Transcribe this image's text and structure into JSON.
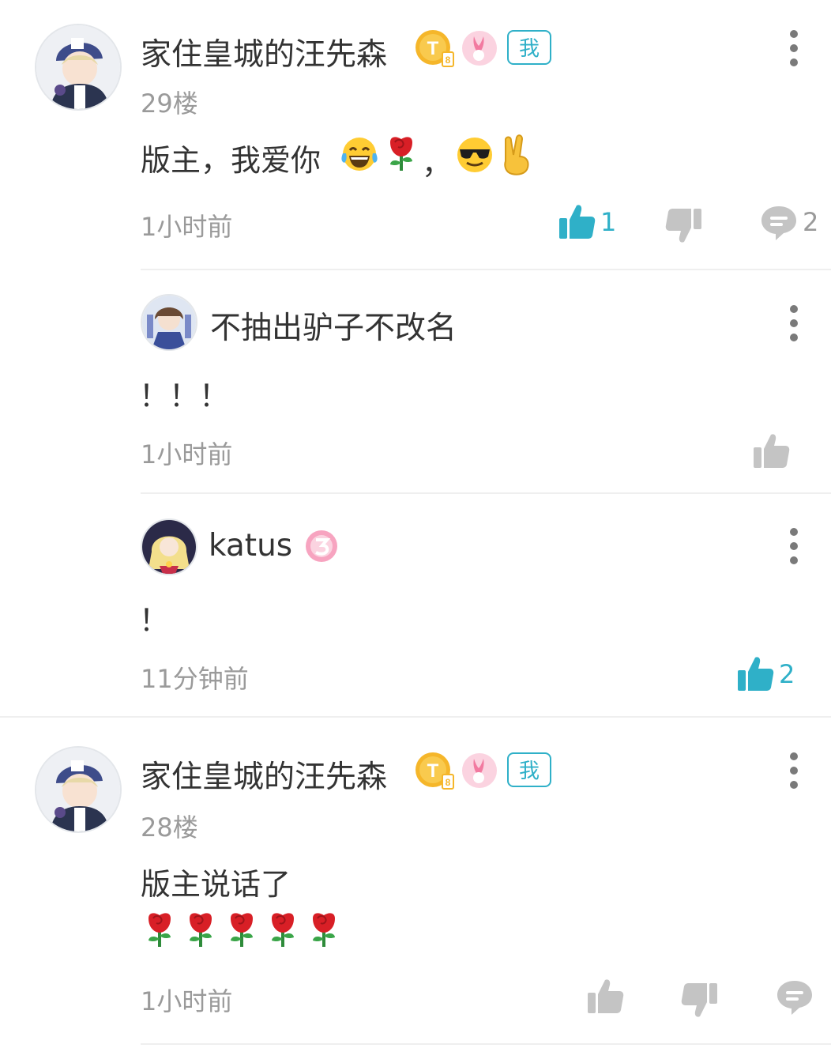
{
  "comments": [
    {
      "author": "家住皇城的汪先森",
      "me_tag": "我",
      "floor": "29楼",
      "text": "版主，我爱你",
      "text_suffix": "，",
      "time": "1小时前",
      "likes": "1",
      "replies": "2"
    },
    {
      "author": "不抽出驴子不改名",
      "text": "！！！",
      "time": "1小时前"
    },
    {
      "author": "katus",
      "text": "！",
      "time": "11分钟前",
      "likes": "2"
    },
    {
      "author": "家住皇城的汪先森",
      "me_tag": "我",
      "floor": "28楼",
      "text": "版主说话了",
      "time": "1小时前"
    }
  ],
  "colors": {
    "accent": "#2fb0c8",
    "muted": "#c4c4c4",
    "gold_badge": "#f5b62a",
    "pink_badge": "#f48fb1"
  }
}
